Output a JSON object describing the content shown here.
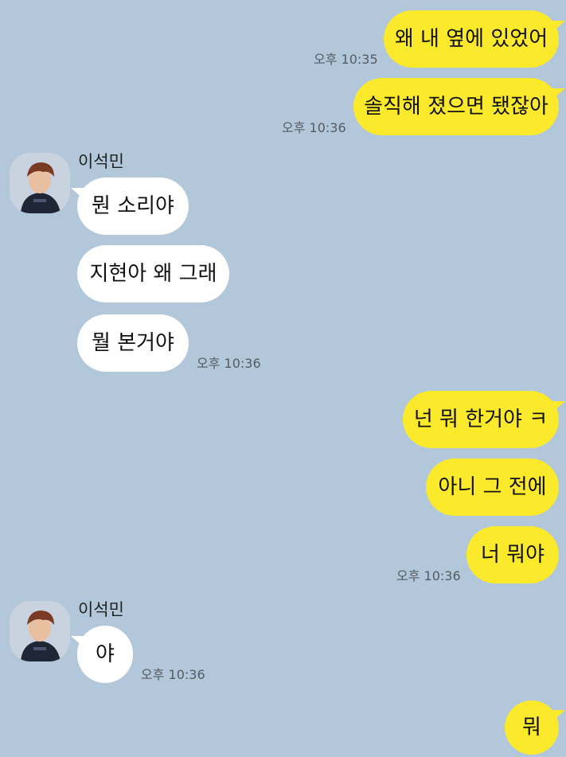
{
  "chat": {
    "messages": [
      {
        "dir": "out",
        "text": "왜 내 옆에 있었어",
        "time": "오후 10:35"
      },
      {
        "dir": "out",
        "text": "솔직해 졌으면 됐잖아",
        "time": "오후 10:36"
      },
      {
        "dir": "in",
        "sender": "이석민",
        "text": "뭔 소리야"
      },
      {
        "dir": "in",
        "text": "지현아 왜 그래"
      },
      {
        "dir": "in",
        "text": "뭘 본거야",
        "time": "오후 10:36"
      },
      {
        "dir": "out",
        "text": "넌 뭐 한거야 ㅋ"
      },
      {
        "dir": "out",
        "text": "아니 그 전에"
      },
      {
        "dir": "out",
        "text": "너 뭐야",
        "time": "오후 10:36"
      },
      {
        "dir": "in",
        "sender": "이석민",
        "text": "야",
        "time": "오후 10:36"
      },
      {
        "dir": "out",
        "text": "뭐"
      }
    ]
  },
  "colors": {
    "background": "#b2c7d9",
    "outgoing_bubble": "#fbe92c",
    "incoming_bubble": "#ffffff"
  },
  "icons": {
    "avatar": "profile-photo-icon"
  }
}
